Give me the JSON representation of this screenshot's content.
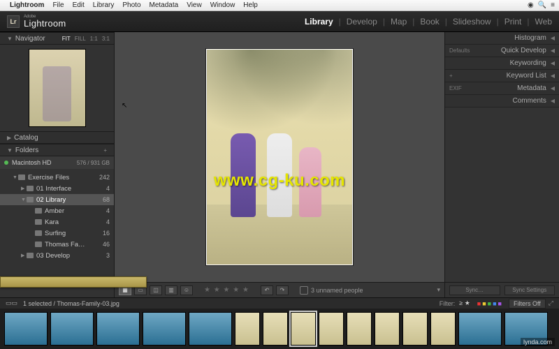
{
  "mac_menu": {
    "app": "Lightroom",
    "items": [
      "File",
      "Edit",
      "Library",
      "Photo",
      "Metadata",
      "View",
      "Window",
      "Help"
    ]
  },
  "brand": {
    "adobe": "Adobe",
    "product": "Lightroom"
  },
  "modules": [
    "Library",
    "Develop",
    "Map",
    "Book",
    "Slideshow",
    "Print",
    "Web"
  ],
  "active_module": "Library",
  "left_panel": {
    "navigator": {
      "title": "Navigator",
      "options": [
        "FIT",
        "FILL",
        "1:1",
        "3:1"
      ],
      "active_option": "FIT"
    },
    "catalog": {
      "title": "Catalog"
    },
    "folders": {
      "title": "Folders",
      "volume": {
        "name": "Macintosh HD",
        "capacity": "576 / 931 GB"
      },
      "tree": [
        {
          "name": "Exercise Files",
          "count": 242,
          "indent": 1,
          "expanded": true
        },
        {
          "name": "01 Interface",
          "count": 4,
          "indent": 2,
          "expanded": false
        },
        {
          "name": "02 Library",
          "count": 68,
          "indent": 2,
          "expanded": true,
          "selected": true
        },
        {
          "name": "Amber",
          "count": 4,
          "indent": 3
        },
        {
          "name": "Kara",
          "count": 4,
          "indent": 3
        },
        {
          "name": "Surfing",
          "count": 16,
          "indent": 3
        },
        {
          "name": "Thomas Fa…",
          "count": 46,
          "indent": 3
        },
        {
          "name": "03 Develop",
          "count": 3,
          "indent": 2,
          "expanded": false
        }
      ]
    }
  },
  "right_panel": {
    "rows": [
      {
        "label": "Histogram",
        "pre": ""
      },
      {
        "label": "Quick Develop",
        "pre": "Defaults"
      },
      {
        "label": "Keywording",
        "pre": ""
      },
      {
        "label": "Keyword List",
        "pre": "+"
      },
      {
        "label": "Metadata",
        "pre": "EXIF"
      },
      {
        "label": "Comments",
        "pre": ""
      }
    ],
    "sync": {
      "left": "Sync…",
      "right": "Sync Settings"
    }
  },
  "toolbar": {
    "people_text": "3 unnamed people"
  },
  "secondary_bar": {
    "path": "1 selected / Thomas-Family-03.jpg",
    "filter_label": "Filter:",
    "filter_stars": "≥ ★",
    "filters_off": "Filters Off"
  },
  "watermark": "www.cg-ku.com",
  "brand_corner": "lynda.com"
}
